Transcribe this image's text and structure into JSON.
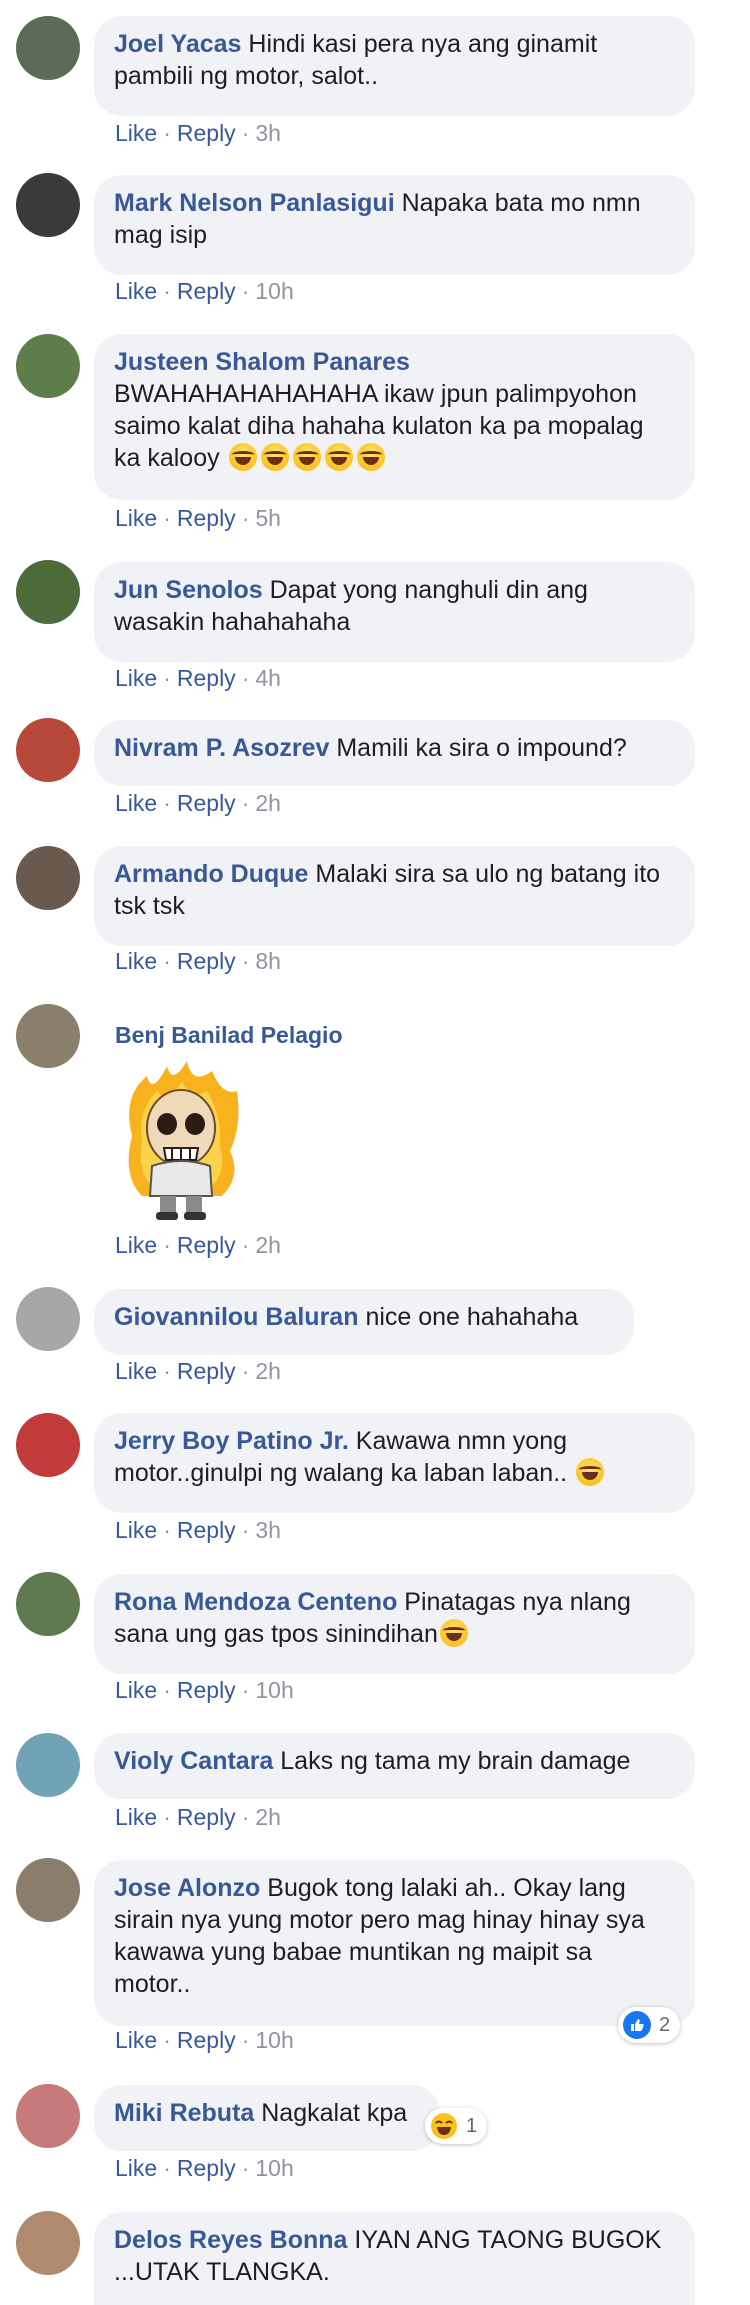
{
  "comments": [
    {
      "author": "Joel Yacas",
      "text": "Hindi kasi pera nya ang ginamit pambili ng motor, salot..",
      "like": "Like",
      "reply": "Reply",
      "time": "3h"
    },
    {
      "author": "Mark Nelson Panlasigui",
      "text": "Napaka bata mo nmn mag isip",
      "like": "Like",
      "reply": "Reply",
      "time": "10h"
    },
    {
      "author": "Justeen Shalom Panares",
      "text": "BWAHAHAHAHAHAHA ikaw jpun palimpyohon saimo kalat diha hahaha kulaton ka pa mopalag ka kalooy",
      "emoji_count": 5,
      "like": "Like",
      "reply": "Reply",
      "time": "5h"
    },
    {
      "author": "Jun Senolos",
      "text": "Dapat yong nanghuli din ang wasakin hahahahaha",
      "like": "Like",
      "reply": "Reply",
      "time": "4h"
    },
    {
      "author": "Nivram P. Asozrev",
      "text": "Mamili ka sira o impound?",
      "like": "Like",
      "reply": "Reply",
      "time": "2h"
    },
    {
      "author": "Armando Duque",
      "text": "Malaki sira sa ulo ng batang ito tsk tsk",
      "like": "Like",
      "reply": "Reply",
      "time": "8h"
    },
    {
      "author": "Benj Banilad Pelagio",
      "text": "",
      "sticker": "skull-flame-sticker",
      "like": "Like",
      "reply": "Reply",
      "time": "2h"
    },
    {
      "author": "Giovannilou Baluran",
      "text": "nice one hahahaha",
      "like": "Like",
      "reply": "Reply",
      "time": "2h"
    },
    {
      "author": "Jerry Boy Patino Jr.",
      "text": "Kawawa nmn yong motor..ginulpi ng walang ka laban laban..",
      "emoji_count": 1,
      "like": "Like",
      "reply": "Reply",
      "time": "3h"
    },
    {
      "author": "Rona Mendoza Centeno",
      "text": "Pinatagas nya nlang sana ung gas tpos sinindihan",
      "emoji_count": 1,
      "like": "Like",
      "reply": "Reply",
      "time": "10h"
    },
    {
      "author": "Violy Cantara",
      "text": "Laks ng tama my brain damage",
      "like": "Like",
      "reply": "Reply",
      "time": "2h"
    },
    {
      "author": "Jose Alonzo",
      "text": "Bugok tong lalaki ah.. Okay lang sirain nya yung motor pero mag hinay hinay sya kawawa yung babae muntikan ng maipit sa motor..",
      "like": "Like",
      "reply": "Reply",
      "time": "10h",
      "reaction_count": "2",
      "reaction": "like-icon"
    },
    {
      "author": "Miki Rebuta",
      "text": "Nagkalat kpa",
      "like": "Like",
      "reply": "Reply",
      "time": "10h",
      "reaction_count": "1",
      "reaction": "haha-icon"
    },
    {
      "author": "Delos Reyes Bonna",
      "text": "IYAN ANG TAONG BUGOK ...UTAK TLANGKA.",
      "like": "Like",
      "reply": "Reply",
      "time": ""
    }
  ],
  "colors": {
    "author": "#385898",
    "bubble": "#f0f2f5",
    "meta_time": "#90949c",
    "like_blue": "#1877f2"
  }
}
